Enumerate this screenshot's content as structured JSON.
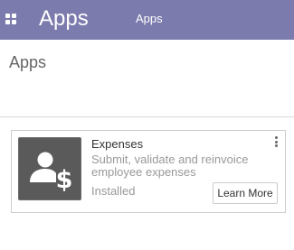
{
  "topbar": {
    "brand": "Apps",
    "menu": [
      "Apps"
    ],
    "apps_icon": "grid-icon",
    "color": "#7c7bad"
  },
  "control_panel": {
    "breadcrumb": "Apps"
  },
  "apps": [
    {
      "name": "Expenses",
      "summary": "Submit, validate and reinvoice employee expenses",
      "status": "Installed",
      "button_label": "Learn More",
      "icon": "user-dollar-icon",
      "icon_bg": "#5a5a5a"
    }
  ]
}
